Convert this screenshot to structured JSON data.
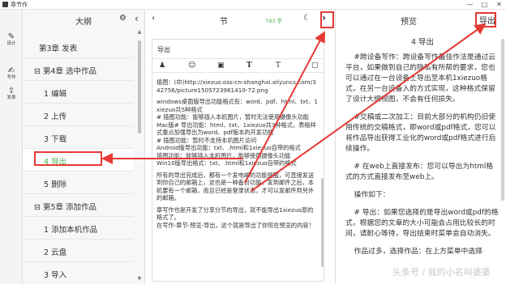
{
  "window": {
    "title": "章节作",
    "minimize": "—",
    "maximize": "□",
    "close": "✕"
  },
  "activity": [
    {
      "icon": "pen-icon",
      "glyph": "✎",
      "label": "设计"
    },
    {
      "icon": "write-icon",
      "glyph": "✍",
      "label": "写作"
    },
    {
      "icon": "publish-icon",
      "glyph": "⇪",
      "label": "发表"
    }
  ],
  "outline": {
    "title": "大纲",
    "gear_glyph": "⚙",
    "collapse_glyph": "‹",
    "items": [
      {
        "label": "第3章 发表"
      },
      {
        "label": "⊟ 第4章 选中作品"
      },
      {
        "label": "1 编辑"
      },
      {
        "label": "2 上传"
      },
      {
        "label": "3 下载"
      },
      {
        "label": "4 导出"
      },
      {
        "label": "5 删除"
      },
      {
        "label": "⊟ 第5章 添加作品"
      },
      {
        "label": "1 添加本机作品"
      },
      {
        "label": "2 云盘"
      },
      {
        "label": "3 导入"
      }
    ],
    "selected_index": 5
  },
  "editor": {
    "title": "节",
    "back_glyph": "‹",
    "word_count": "793 字",
    "moon_glyph": "☾",
    "forward_glyph": "›",
    "doc_title": "导出",
    "tools": [
      "♟",
      "☺",
      "▣",
      "T",
      "T",
      "▢"
    ],
    "paragraphs": [
      "插图：(中)http://xiezuo.oss-cn-shanghai.aliyuncs.com/342756/picture15057239614​10-72.png",
      "windows桌面版导出功能格式有：word、pdf、html、txt、1xiezuo共5种格式\n# 插图功能：能够插入本机图片，暂时无法使用摄像头功能\nMac版# 导出功能：html、txt、1xiezuo共3种格式，表格样式重点加强导出为word、pdf版本的开发功能\n# 插图功能：暂时不支持本机图片访问\nAndroid版导出功能：txt、.html和1xiezuo自带的格式\n插图功能：能够插入本机图片，能够使用摄像头功能\nWin10版导出格式：txt、.html和1xiezuo自带的格式",
      "所有的导出完成后，都有一个发电邮的功能提醒，可直接发送到你自己的邮箱上，这也是一种备份功能，发到邮件之后，本机要有一个邮箱，而且已经是登录状态，才可以发邮件到另外的邮箱。",
      "章写作也是开发了分享分节的导出，就不能导出1xiezuo原的格式了。\n在写作-章节-预览-导出，这个就是导出了你现在预览的内容！"
    ]
  },
  "preview": {
    "title": "预览",
    "export_label": "导出",
    "heading": "4 导出",
    "paragraphs": [
      "#跨设备写作：跨设备写作最佳作法是通过云平台，如果做到自己的隐私有所帮的要求，您也可以通过在一台设备上导出至本机1xiezuo格式，在另一台设备入的方式实现，这种格式保留了设计大纲视图，不会有任何损失。",
      "#交稿或二次加工：目前大部分的机构仍旧使用传统的交稿格式，即word或pdf格式，您可以将作品导出获得工业化的word或pdf格式进行后续操作。",
      "# 在web上直接发布：您可以导出为html格式的方式直接发布至web上。",
      "操作如下：",
      "# 导出：如果您选择的是导出word或pdf的格式，根据您的文章的大小可能会占用比较长的时间，请耐心等待，导出结束时菜单会自动消失。",
      "作品过多，选择作品：在上方菜单中选择"
    ]
  },
  "watermark": "头条号 / 我的小名叫婆婆",
  "colors": {
    "accent_green": "#4caf50",
    "highlight_red": "#e53935"
  }
}
